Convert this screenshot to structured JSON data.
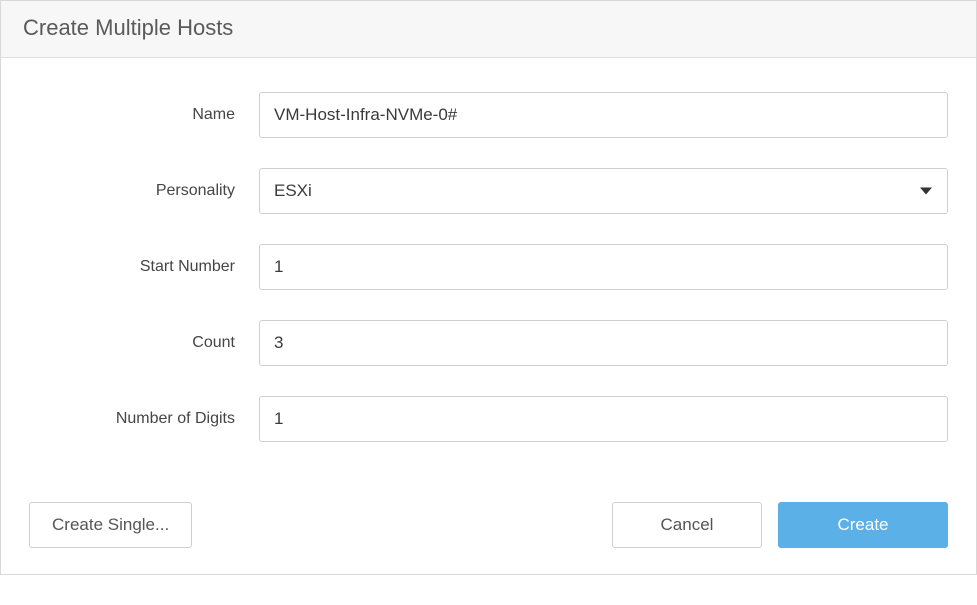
{
  "dialog": {
    "title": "Create Multiple Hosts"
  },
  "form": {
    "name": {
      "label": "Name",
      "value": "VM-Host-Infra-NVMe-0#"
    },
    "personality": {
      "label": "Personality",
      "value": "ESXi"
    },
    "start_number": {
      "label": "Start Number",
      "value": "1"
    },
    "count": {
      "label": "Count",
      "value": "3"
    },
    "number_of_digits": {
      "label": "Number of Digits",
      "value": "1"
    }
  },
  "footer": {
    "create_single": "Create Single...",
    "cancel": "Cancel",
    "create": "Create"
  }
}
